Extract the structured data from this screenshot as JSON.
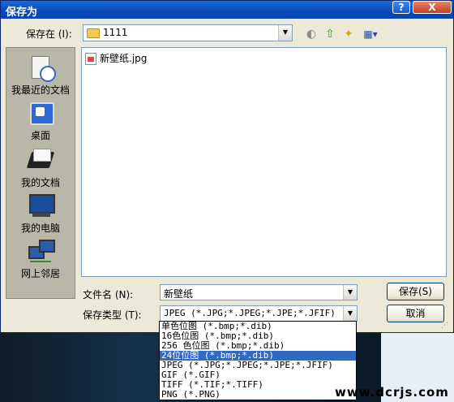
{
  "window": {
    "title": "保存为",
    "help_glyph": "?",
    "close_glyph": "X"
  },
  "save_in": {
    "label": "保存在 (I):",
    "value": "1111"
  },
  "toolbar": {
    "back_glyph": "◐",
    "up_glyph": "⇧",
    "newfolder_glyph": "✦",
    "views_glyph": "▦▾"
  },
  "places": [
    {
      "label": "我最近的文档",
      "icon": "recent-documents-icon"
    },
    {
      "label": "桌面",
      "icon": "desktop-icon"
    },
    {
      "label": "我的文档",
      "icon": "my-documents-icon"
    },
    {
      "label": "我的电脑",
      "icon": "my-computer-icon"
    },
    {
      "label": "网上邻居",
      "icon": "network-places-icon"
    }
  ],
  "files": [
    {
      "name": "新壁纸.jpg"
    }
  ],
  "filename": {
    "label": "文件名 (N):",
    "value": "新壁纸"
  },
  "filetype": {
    "label": "保存类型 (T):",
    "value": "JPEG (*.JPG;*.JPEG;*.JPE;*.JFIF)",
    "options": [
      "单色位图 (*.bmp;*.dib)",
      "16色位图 (*.bmp;*.dib)",
      "256 色位图 (*.bmp;*.dib)",
      "24位位图 (*.bmp;*.dib)",
      "JPEG (*.JPG;*.JPEG;*.JPE;*.JFIF)",
      "GIF (*.GIF)",
      "TIFF (*.TIF;*.TIFF)",
      "PNG (*.PNG)"
    ],
    "selected_index": 3
  },
  "buttons": {
    "save": "保存(S)",
    "cancel": "取消"
  },
  "watermark": "www.dcrjs.com"
}
